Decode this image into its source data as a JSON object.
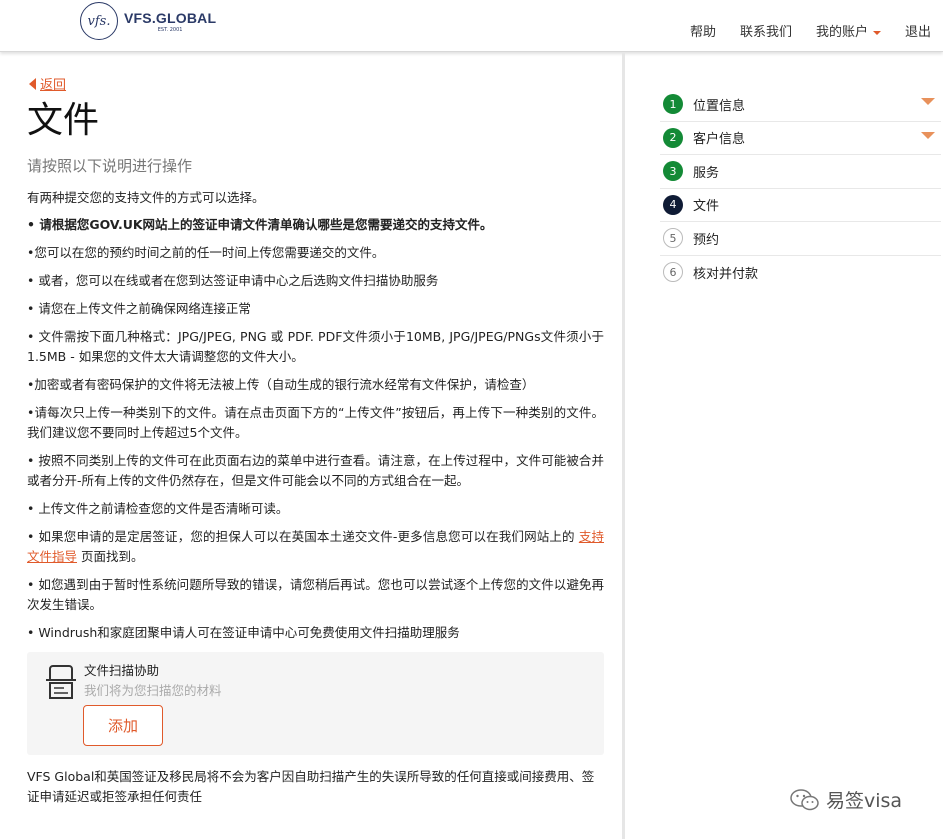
{
  "header": {
    "logo_mark": "vfs.",
    "logo_name": "VFS.GLOBAL",
    "logo_est": "EST. 2001",
    "nav": {
      "help": "帮助",
      "contact": "联系我们",
      "account": "我的账户",
      "logout": "退出"
    }
  },
  "main": {
    "back_label": "返回",
    "title": "文件",
    "subtitle": "请按照以下说明进行操作",
    "intro": "有两种提交您的支持文件的方式可以选择。",
    "paragraphs": [
      "• 请根据您GOV.UK网站上的签证申请文件清单确认哪些是您需要递交的支持文件。",
      "•您可以在您的预约时间之前的任一时间上传您需要递交的文件。",
      "• 或者，您可以在线或者在您到达签证申请中心之后选购文件扫描协助服务",
      "• 请您在上传文件之前确保网络连接正常",
      "• 文件需按下面几种格式：JPG/JPEG, PNG 或 PDF. PDF文件须小于10MB, JPG/JPEG/PNGs文件须小于1.5MB - 如果您的文件太大请调整您的文件大小。",
      "•加密或者有密码保护的文件将无法被上传（自动生成的银行流水经常有文件保护，请检查）",
      "•请每次只上传一种类别下的文件。请在点击页面下方的“上传文件”按钮后，再上传下一种类别的文件。我们建议您不要同时上传超过5个文件。",
      "• 按照不同类别上传的文件可在此页面右边的菜单中进行查看。请注意，在上传过程中，文件可能被合并或者分开-所有上传的文件仍然存在，但是文件可能会以不同的方式组合在一起。",
      "• 上传文件之前请检查您的文件是否清晰可读。"
    ],
    "settlement_para": {
      "before": "• 如果您申请的是定居签证，您的担保人可以在英国本土递交文件-更多信息您可以在我们网站上的 ",
      "link": "支持文件指导",
      "after": " 页面找到。"
    },
    "paragraphs_after": [
      "• 如您遇到由于暂时性系统问题所导致的错误，请您稍后再试。您也可以尝试逐个上传您的文件以避免再次发生错误。",
      "• Windrush和家庭团聚申请人可在签证申请中心可免费使用文件扫描助理服务"
    ],
    "scan_service": {
      "icon": "scanner-icon",
      "title": "文件扫描协助",
      "subtitle": "我们将为您扫描您的材料",
      "add_button": "添加"
    },
    "footer_note": "VFS Global和英国签证及移民局将不会为客户因自助扫描产生的失误所导致的任何直接或间接费用、签证申请延迟或拒签承担任何责任"
  },
  "steps": [
    {
      "num": "1",
      "label": "位置信息",
      "state": "done",
      "expandable": true
    },
    {
      "num": "2",
      "label": "客户信息",
      "state": "done",
      "expandable": true
    },
    {
      "num": "3",
      "label": "服务",
      "state": "done",
      "expandable": false
    },
    {
      "num": "4",
      "label": "文件",
      "state": "current",
      "expandable": false
    },
    {
      "num": "5",
      "label": "预约",
      "state": "todo",
      "expandable": false
    },
    {
      "num": "6",
      "label": "核对并付款",
      "state": "todo",
      "expandable": false
    }
  ],
  "watermark": {
    "icon": "wechat-icon",
    "text": "易签visa"
  },
  "colors": {
    "accent": "#e05a2b",
    "step_done": "#138a36",
    "step_current": "#0f1b35"
  }
}
